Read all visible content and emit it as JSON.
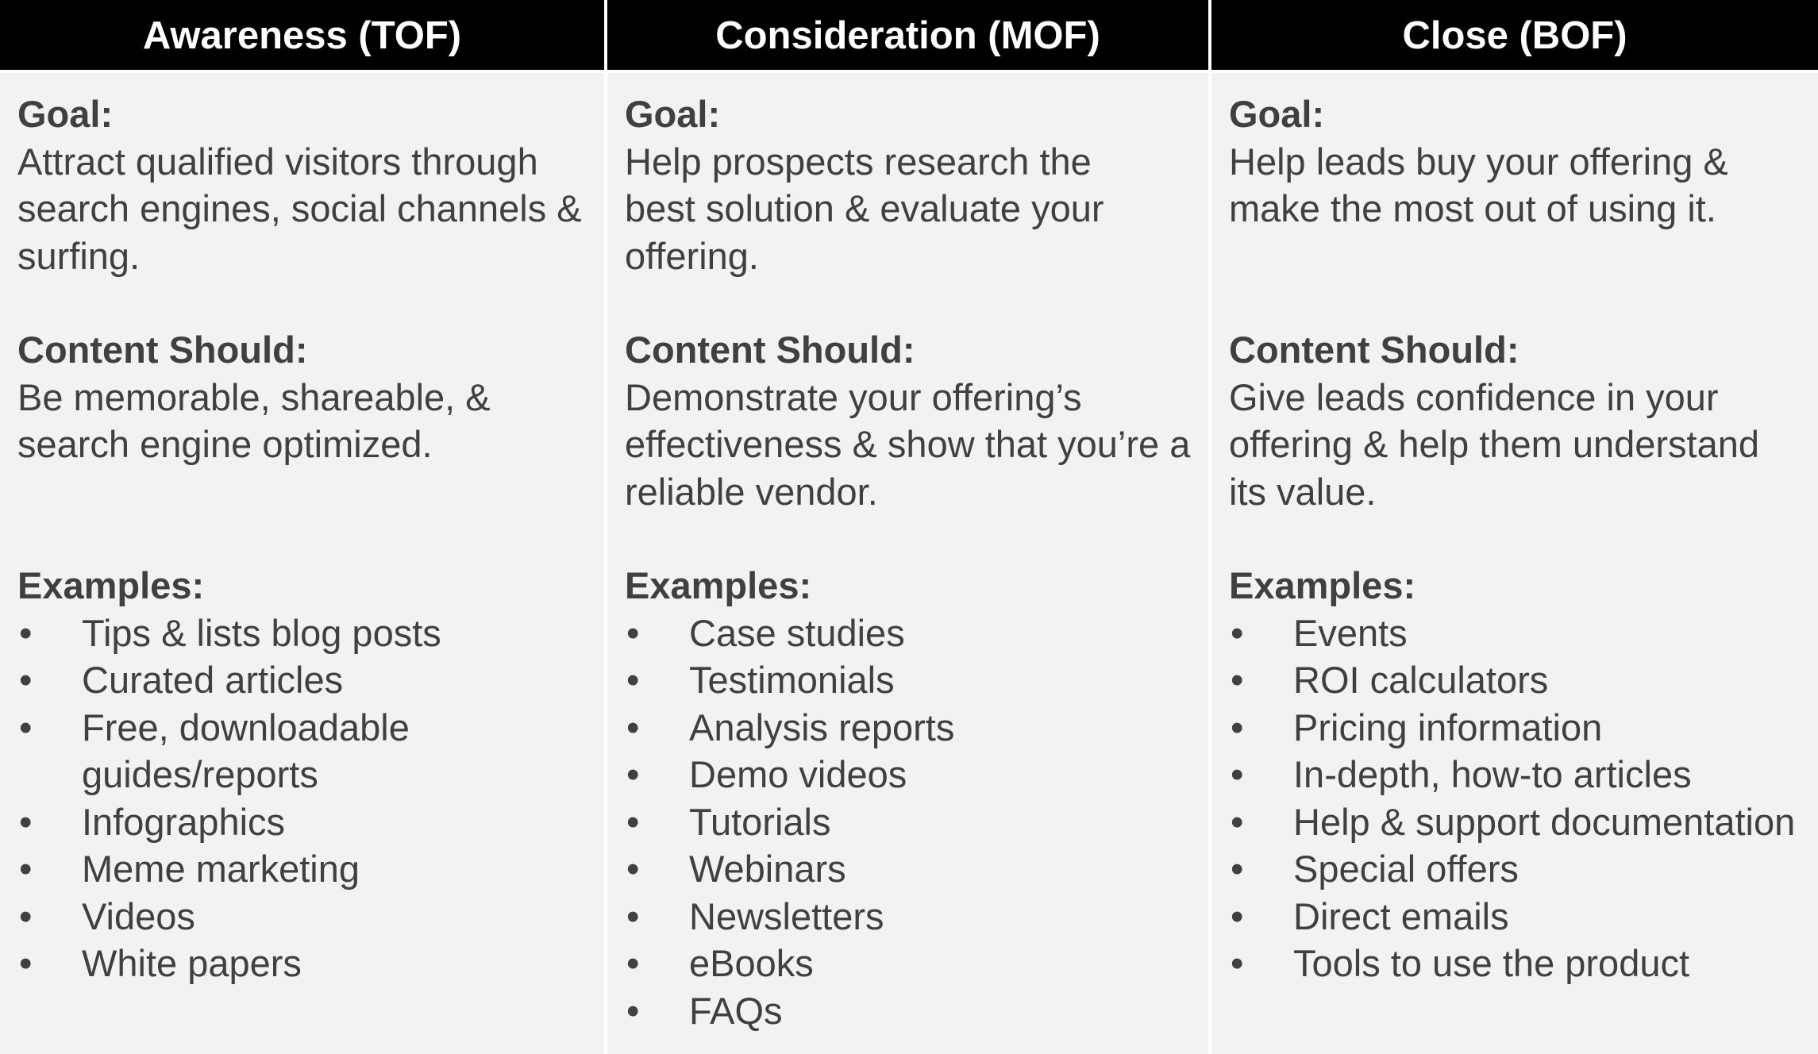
{
  "columns": [
    {
      "header": "Awareness (TOF)",
      "goal_label": "Goal:",
      "goal_text": "Attract qualified visitors through search engines, social channels & surfing.",
      "content_label": "Content Should:",
      "content_text": "Be memorable, shareable, & search engine optimized.",
      "examples_label": "Examples:",
      "examples": [
        "Tips & lists blog posts",
        "Curated articles",
        "Free, downloadable guides/reports",
        "Infographics",
        "Meme marketing",
        "Videos",
        "White papers"
      ]
    },
    {
      "header": "Consideration (MOF)",
      "goal_label": "Goal:",
      "goal_text": "Help prospects research the best solution & evaluate your offering.",
      "content_label": "Content Should:",
      "content_text": "Demonstrate your offering’s effectiveness & show that you’re a reliable vendor.",
      "examples_label": "Examples:",
      "examples": [
        "Case studies",
        "Testimonials",
        "Analysis reports",
        "Demo videos",
        "Tutorials",
        "Webinars",
        "Newsletters",
        "eBooks",
        "FAQs"
      ]
    },
    {
      "header": "Close (BOF)",
      "goal_label": "Goal:",
      "goal_text": "Help leads buy your offering & make the most out of using it.",
      "content_label": "Content Should:",
      "content_text": "Give leads confidence in your offering & help them understand its value.",
      "examples_label": "Examples:",
      "examples": [
        "Events",
        "ROI calculators",
        "Pricing information",
        "In-depth, how-to articles",
        "Help & support documentation",
        "Special offers",
        "Direct emails",
        "Tools to use the product"
      ]
    }
  ],
  "bullet_glyph": "•"
}
